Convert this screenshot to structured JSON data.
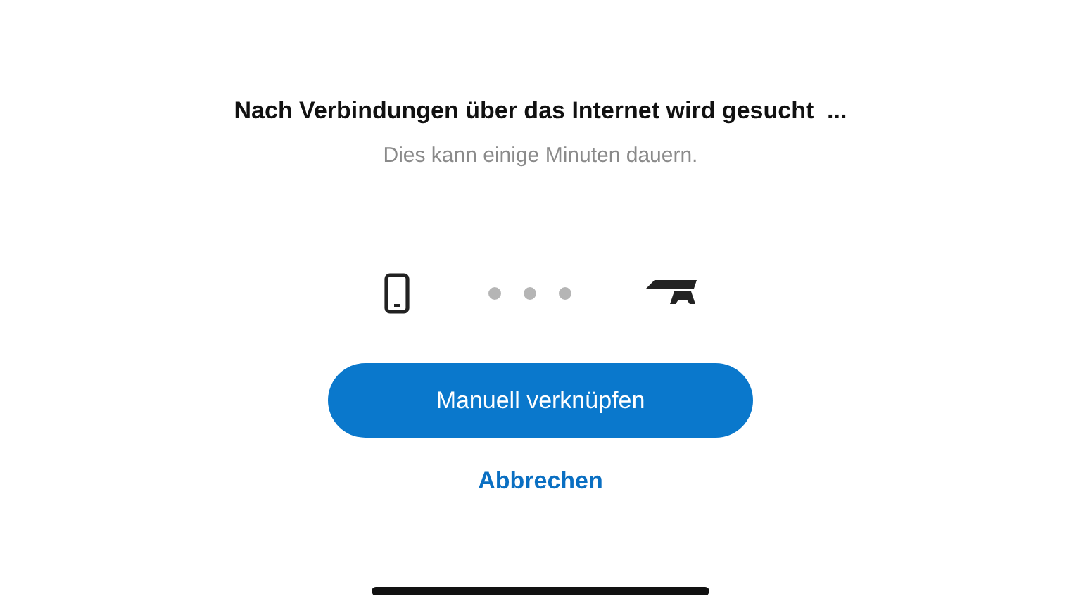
{
  "title": "Nach Verbindungen über das Internet wird gesucht  ...",
  "subtitle": "Dies kann einige Minuten dauern.",
  "primary_button": {
    "label": "Manuell verknüpfen"
  },
  "cancel_link": {
    "label": "Abbrechen"
  }
}
